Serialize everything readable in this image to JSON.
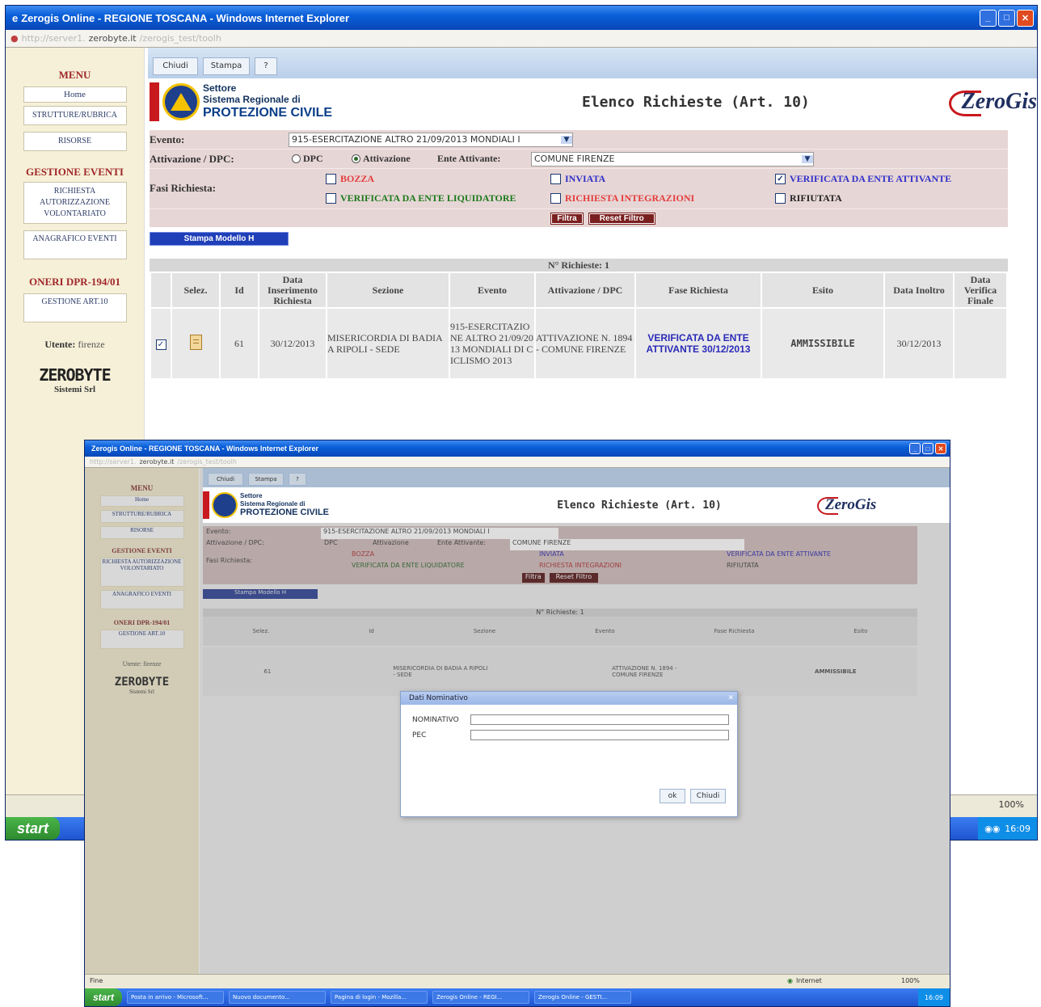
{
  "window": {
    "title": "Zerogis Online - REGIONE TOSCANA - Windows Internet Explorer",
    "address_prefix": "http://server1.",
    "address_domain": "zerobyte.it",
    "address_suffix": "/zerogis_test/toolh",
    "zoom": "100%"
  },
  "sidebar": {
    "menu_title": "MENU",
    "menu_items": [
      "Home",
      "STRUTTURE/RUBRICA",
      "RISORSE"
    ],
    "section_events": "GESTIONE EVENTI",
    "event_items": [
      "RICHIESTA AUTORIZZAZIONE VOLONTARIATO",
      "ANAGRAFICO EVENTI"
    ],
    "section_oneri": "ONERI DPR-194/01",
    "oneri_items": [
      "GESTIONE ART.10"
    ],
    "user_label": "Utente:",
    "user_name": "firenze",
    "brand_logo": "ZEROBYTE",
    "brand_sub": "Sistemi Srl"
  },
  "toolbar": {
    "buttons": [
      "Chiudi",
      "Stampa",
      "?"
    ]
  },
  "header": {
    "org_line1": "Settore",
    "org_line2": "Sistema Regionale di",
    "org_line3": "PROTEZIONE CIVILE",
    "title": "Elenco Richieste (Art. 10)",
    "brand": "ZeroGis"
  },
  "filter": {
    "evento_label": "Evento:",
    "evento_value": "915-ESERCITAZIONE ALTRO 21/09/2013 MONDIALI I",
    "attivazione_label": "Attivazione / DPC:",
    "dpc_option": "DPC",
    "attivazione_option": "Attivazione",
    "ente_label": "Ente Attivante:",
    "ente_value": "COMUNE FIRENZE",
    "fasi_label": "Fasi Richiesta:",
    "fasi": [
      {
        "label": "BOZZA",
        "checked": false,
        "color": "red"
      },
      {
        "label": "INVIATA",
        "checked": false,
        "color": "blue"
      },
      {
        "label": "VERIFICATA DA ENTE ATTIVANTE",
        "checked": true,
        "color": "blue"
      },
      {
        "label": "VERIFICATA DA ENTE LIQUIDATORE",
        "checked": false,
        "color": "green"
      },
      {
        "label": "RICHIESTA INTEGRAZIONI",
        "checked": false,
        "color": "red"
      },
      {
        "label": "RIFIUTATA",
        "checked": false,
        "color": "dark"
      }
    ],
    "filtra_button": "Filtra",
    "reset_button": "Reset Filtro"
  },
  "print_button": "Stampa Modello H",
  "table": {
    "count_label": "N° Richieste: 1",
    "columns": [
      "",
      "Selez.",
      "Id",
      "Data Inserimento Richiesta",
      "Sezione",
      "Evento",
      "Attivazione / DPC",
      "Fase Richiesta",
      "Esito",
      "Data Inoltro",
      "Data Verifica Finale"
    ],
    "rows": [
      {
        "checked": true,
        "id": "61",
        "data_inserimento": "30/12/2013",
        "sezione": "MISERICORDIA DI BADIA A RIPOLI - SEDE",
        "evento": "915-ESERCITAZIONE ALTRO 21/09/2013 MONDIALI DI CICLISMO 2013",
        "attivazione": "ATTIVAZIONE N. 1894 - COMUNE FIRENZE",
        "fase": "VERIFICATA DA ENTE ATTIVANTE 30/12/2013",
        "esito": "AMMISSIBILE",
        "data_inoltro": "30/12/2013",
        "data_verifica": ""
      }
    ]
  },
  "taskbar": {
    "start": "start",
    "clock": "16:09",
    "items": [
      "Posta in arrivo - Microsoft...",
      "Nuovo documento...",
      "Pagina di login - Mozilla...",
      "Zerogis Online - REGI...",
      "Zerogis Online - GESTI..."
    ]
  },
  "statusbar": {
    "left": "Fine",
    "zone": "Internet",
    "zoom": "100%"
  },
  "dialog": {
    "title": "Dati Nominativo",
    "field1_label": "NOMINATIVO",
    "field2_label": "PEC",
    "ok_button": "ok",
    "close_button": "Chiudi"
  }
}
